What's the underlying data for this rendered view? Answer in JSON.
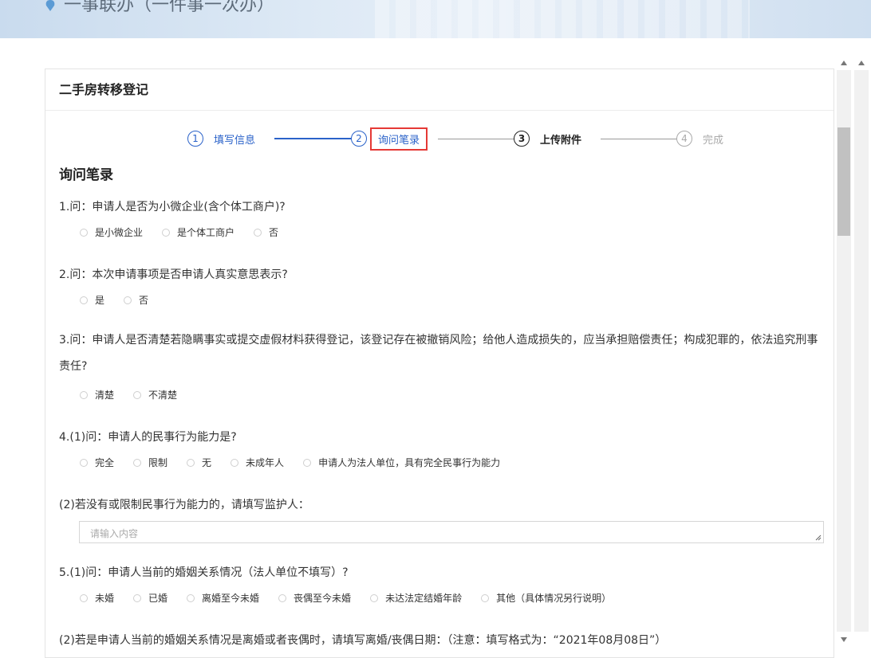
{
  "banner": {
    "title": "一事联办（一件事一次办）"
  },
  "panel": {
    "title": "二手房转移登记"
  },
  "steps": [
    {
      "num": "1",
      "label": "填写信息"
    },
    {
      "num": "2",
      "label": "询问笔录"
    },
    {
      "num": "3",
      "label": "上传附件"
    },
    {
      "num": "4",
      "label": "完成"
    }
  ],
  "section_title": "询问笔录",
  "questions": {
    "q1": {
      "text": "1.问：申请人是否为小微企业(含个体工商户)?",
      "options": [
        "是小微企业",
        "是个体工商户",
        "否"
      ]
    },
    "q2": {
      "text": "2.问：本次申请事项是否申请人真实意思表示?",
      "options": [
        "是",
        "否"
      ]
    },
    "q3": {
      "text": "3.问：申请人是否清楚若隐瞒事实或提交虚假材料获得登记，该登记存在被撤销风险；给他人造成损失的，应当承担赔偿责任；构成犯罪的，依法追究刑事责任?",
      "options": [
        "清楚",
        "不清楚"
      ]
    },
    "q4": {
      "text": "4.(1)问：申请人的民事行为能力是?",
      "options": [
        "完全",
        "限制",
        "无",
        "未成年人",
        "申请人为法人单位，具有完全民事行为能力"
      ]
    },
    "q4b": {
      "text": "(2)若没有或限制民事行为能力的，请填写监护人：",
      "placeholder": "请输入内容"
    },
    "q5": {
      "text": "5.(1)问：申请人当前的婚姻关系情况（法人单位不填写）?",
      "options": [
        "未婚",
        "已婚",
        "离婚至今未婚",
        "丧偶至今未婚",
        "未达法定结婚年龄",
        "其他（具体情况另行说明）"
      ]
    },
    "q5b": {
      "text": "(2)若是申请人当前的婚姻关系情况是离婚或者丧偶时，请填写离婚/丧偶日期：（注意：填写格式为：“2021年08月08日”）"
    }
  },
  "colors": {
    "accent": "#2a62c9",
    "highlight_border": "#e53935",
    "muted": "#aaaaaa"
  }
}
